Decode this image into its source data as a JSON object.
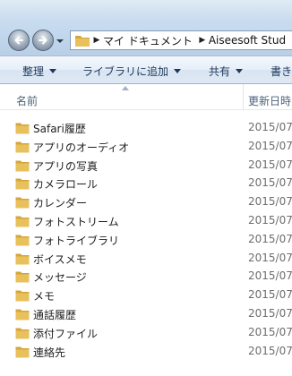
{
  "address": {
    "segments": [
      "マイ ドキュメント",
      "Aiseesoft Stud"
    ]
  },
  "toolbar": {
    "organize_label": "整理",
    "library_label": "ライブラリに追加",
    "share_label": "共有",
    "burn_label": "書き"
  },
  "columns": {
    "name_label": "名前",
    "date_label": "更新日時"
  },
  "files": [
    {
      "name": "Safari履歴",
      "date": "2015/07"
    },
    {
      "name": "アプリのオーディオ",
      "date": "2015/07"
    },
    {
      "name": "アプリの写真",
      "date": "2015/07"
    },
    {
      "name": "カメラロール",
      "date": "2015/07"
    },
    {
      "name": "カレンダー",
      "date": "2015/07"
    },
    {
      "name": "フォトストリーム",
      "date": "2015/07"
    },
    {
      "name": "フォトライブラリ",
      "date": "2015/07"
    },
    {
      "name": "ボイスメモ",
      "date": "2015/07"
    },
    {
      "name": "メッセージ",
      "date": "2015/07"
    },
    {
      "name": "メモ",
      "date": "2015/07"
    },
    {
      "name": "通話履歴",
      "date": "2015/07"
    },
    {
      "name": "添付ファイル",
      "date": "2015/07"
    },
    {
      "name": "連絡先",
      "date": "2015/07"
    }
  ],
  "icons": {
    "back": "back-arrow-icon",
    "forward": "forward-arrow-icon",
    "folder": "folder-icon",
    "dropdown": "chevron-down-icon"
  },
  "colors": {
    "folder_body": "#e8c15c",
    "folder_tab": "#d4a63a",
    "command_text": "#1e395b"
  }
}
